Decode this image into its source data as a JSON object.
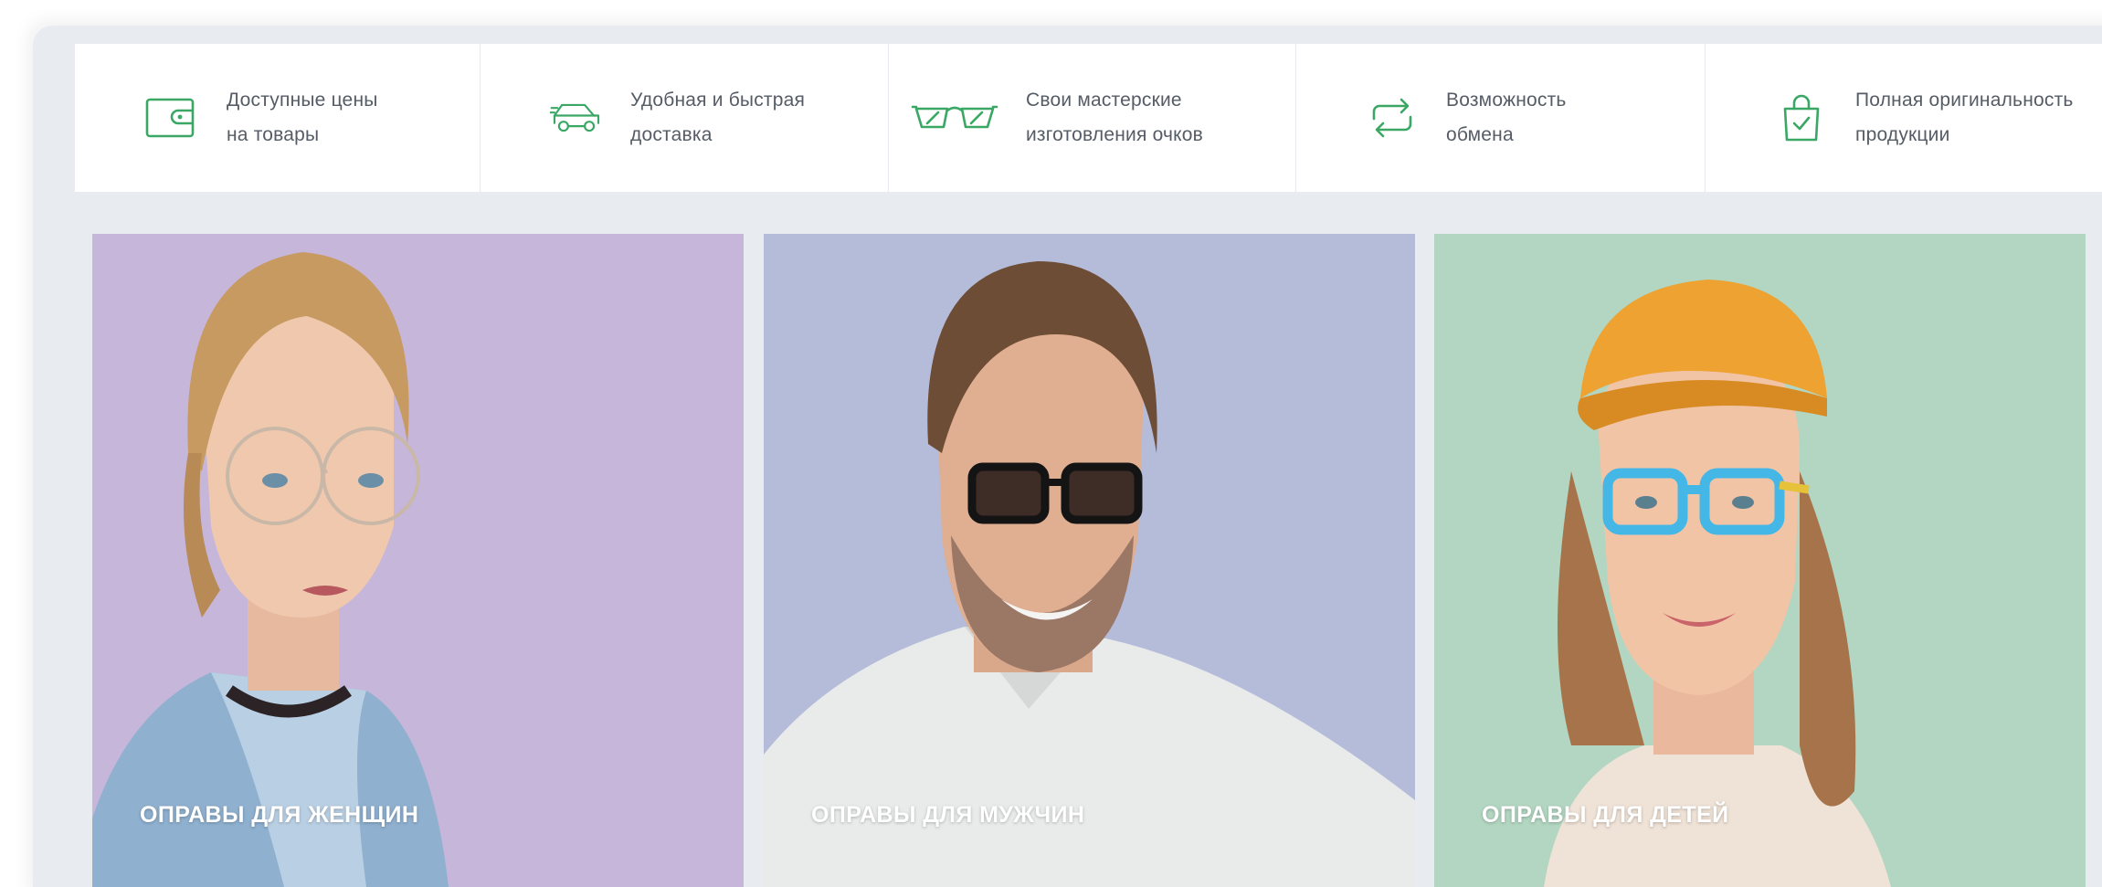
{
  "features": [
    {
      "icon": "wallet-icon",
      "line1": "Доступные цены",
      "line2": "на товары"
    },
    {
      "icon": "delivery-car-icon",
      "line1": "Удобная и быстрая",
      "line2": "доставка"
    },
    {
      "icon": "glasses-icon",
      "line1": "Свои мастерские",
      "line2": "изготовления очков"
    },
    {
      "icon": "exchange-arrows-icon",
      "line1": "Возможность",
      "line2": "обмена"
    },
    {
      "icon": "shopping-bag-check-icon",
      "line1": "Полная оригинальность",
      "line2": "продукции"
    }
  ],
  "categories": [
    {
      "label": "Оправы для женщин",
      "color": "#c6b6da"
    },
    {
      "label": "Оправы для мужчин",
      "color": "#b5bcda"
    },
    {
      "label": "Оправы для детей",
      "color": "#b2d6c1"
    }
  ],
  "colors": {
    "accent": "#3aa864",
    "page_bg": "#e8ecf1"
  }
}
